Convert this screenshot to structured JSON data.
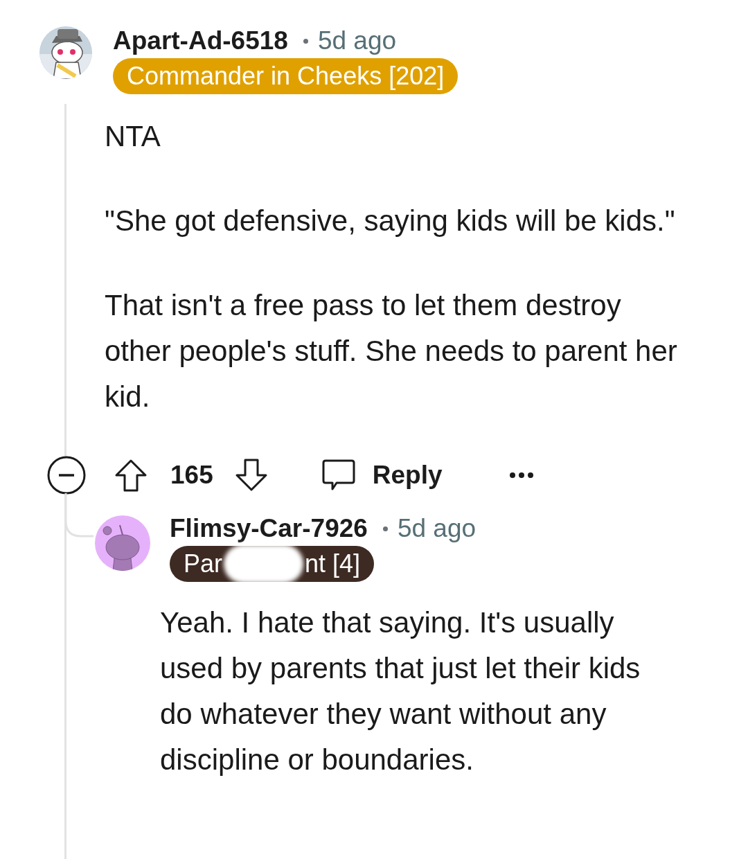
{
  "comment": {
    "author": "Apart-Ad-6518",
    "time": "5d ago",
    "flair": {
      "parts": [
        "Commander in Cheeks [202]"
      ],
      "color": "#e0a100"
    },
    "body": [
      "NTA",
      "\"She got defensive, saying kids will be kids.\"",
      "That isn't a free pass to let them destroy other people's stuff. She needs to parent her kid."
    ],
    "actions": {
      "score": "165",
      "reply": "Reply"
    }
  },
  "reply": {
    "author": "Flimsy-Car-7926",
    "time": "5d ago",
    "flair": {
      "parts": [
        "Par",
        "nt [4]"
      ],
      "color": "#3d2a22"
    },
    "body": [
      "Yeah. I hate that saying. It's usually used by parents that just let their kids do whatever they want without any discipline or boundaries."
    ]
  }
}
